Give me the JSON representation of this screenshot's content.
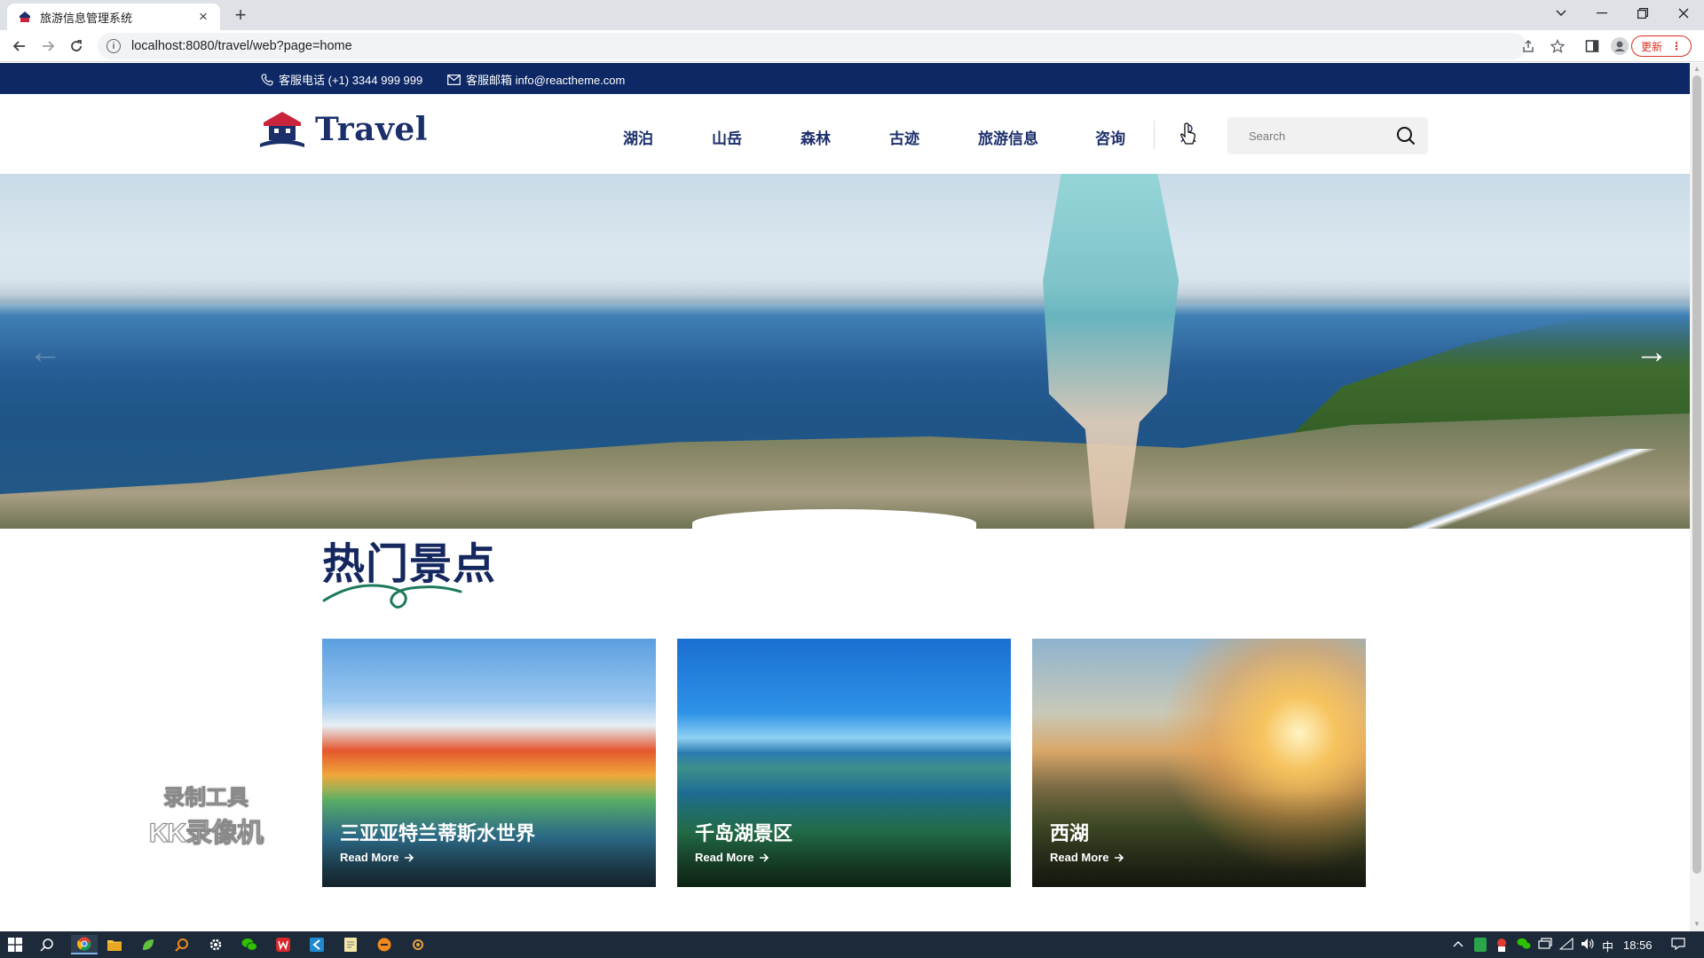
{
  "browser": {
    "tab_title": "旅游信息管理系统",
    "tab_close": "×",
    "new_tab": "+",
    "url": "localhost:8080/travel/web?page=home",
    "update_label": "更新"
  },
  "topbar": {
    "phone": "客服电话 (+1) 3344 999 999",
    "email": "客服邮箱 info@reactheme.com"
  },
  "header": {
    "logo_text": "Travel",
    "nav": [
      "湖泊",
      "山岳",
      "森林",
      "古迹",
      "旅游信息",
      "咨询"
    ],
    "search_placeholder": "Search"
  },
  "hero": {
    "prev": "←",
    "next": "→"
  },
  "section": {
    "title": "热门景点"
  },
  "cards": [
    {
      "title": "三亚亚特兰蒂斯水世界",
      "read_more": "Read More"
    },
    {
      "title": "千岛湖景区",
      "read_more": "Read More"
    },
    {
      "title": "西湖",
      "read_more": "Read More"
    }
  ],
  "watermark": {
    "line1": "录制工具",
    "line2": "KK录像机"
  },
  "taskbar": {
    "ime": "中",
    "time": "18:56"
  },
  "colors": {
    "brand_navy": "#0d2864",
    "nav_text": "#1b2f6b",
    "accent_green": "#1e7a5c",
    "logo_red": "#c8243c"
  }
}
